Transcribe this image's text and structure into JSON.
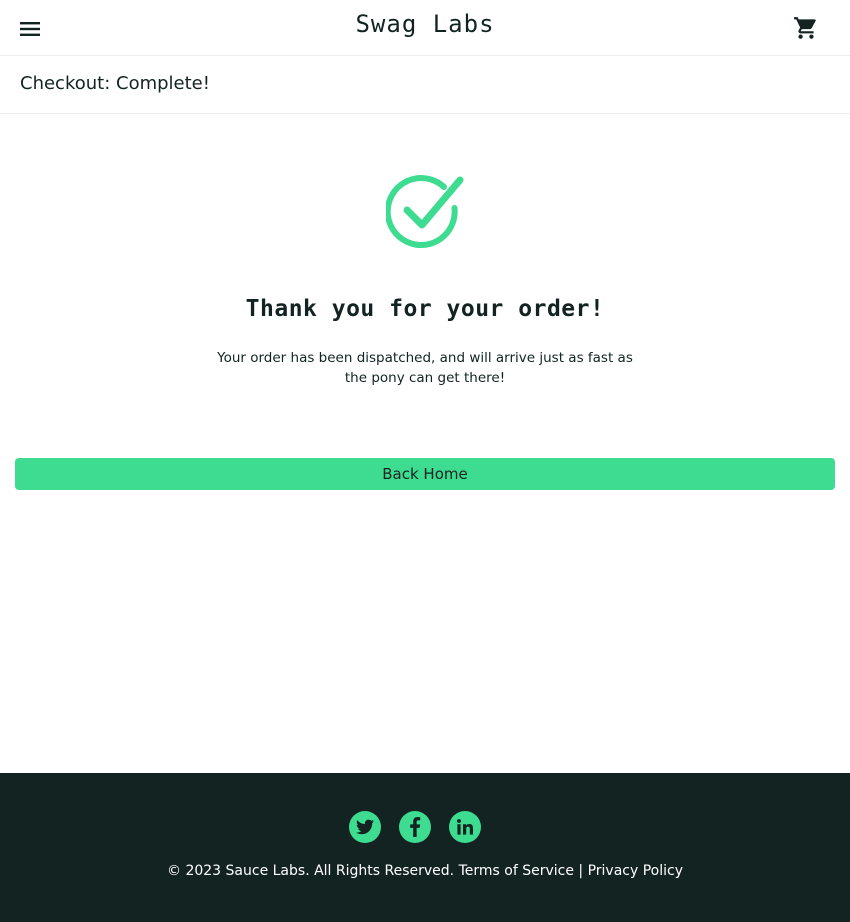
{
  "header": {
    "logo": "Swag Labs",
    "menu_icon": "hamburger-menu-icon",
    "cart_icon": "shopping-cart-icon"
  },
  "secondary_header": {
    "title": "Checkout: Complete!"
  },
  "main": {
    "success_icon": "check-circle-icon",
    "heading": "Thank you for your order!",
    "message": "Your order has been dispatched, and will arrive just as fast as the pony can get there!",
    "back_home_label": "Back Home"
  },
  "footer": {
    "social": [
      {
        "name": "Twitter",
        "icon": "twitter-icon"
      },
      {
        "name": "Facebook",
        "icon": "facebook-icon"
      },
      {
        "name": "LinkedIn",
        "icon": "linkedin-icon"
      }
    ],
    "copyright": "© 2023 Sauce Labs. All Rights Reserved.",
    "terms_label": "Terms of Service",
    "separator": "|",
    "privacy_label": "Privacy Policy"
  },
  "colors": {
    "accent": "#3ddc91",
    "dark": "#132322",
    "border": "#ededed",
    "background": "#ffffff"
  }
}
